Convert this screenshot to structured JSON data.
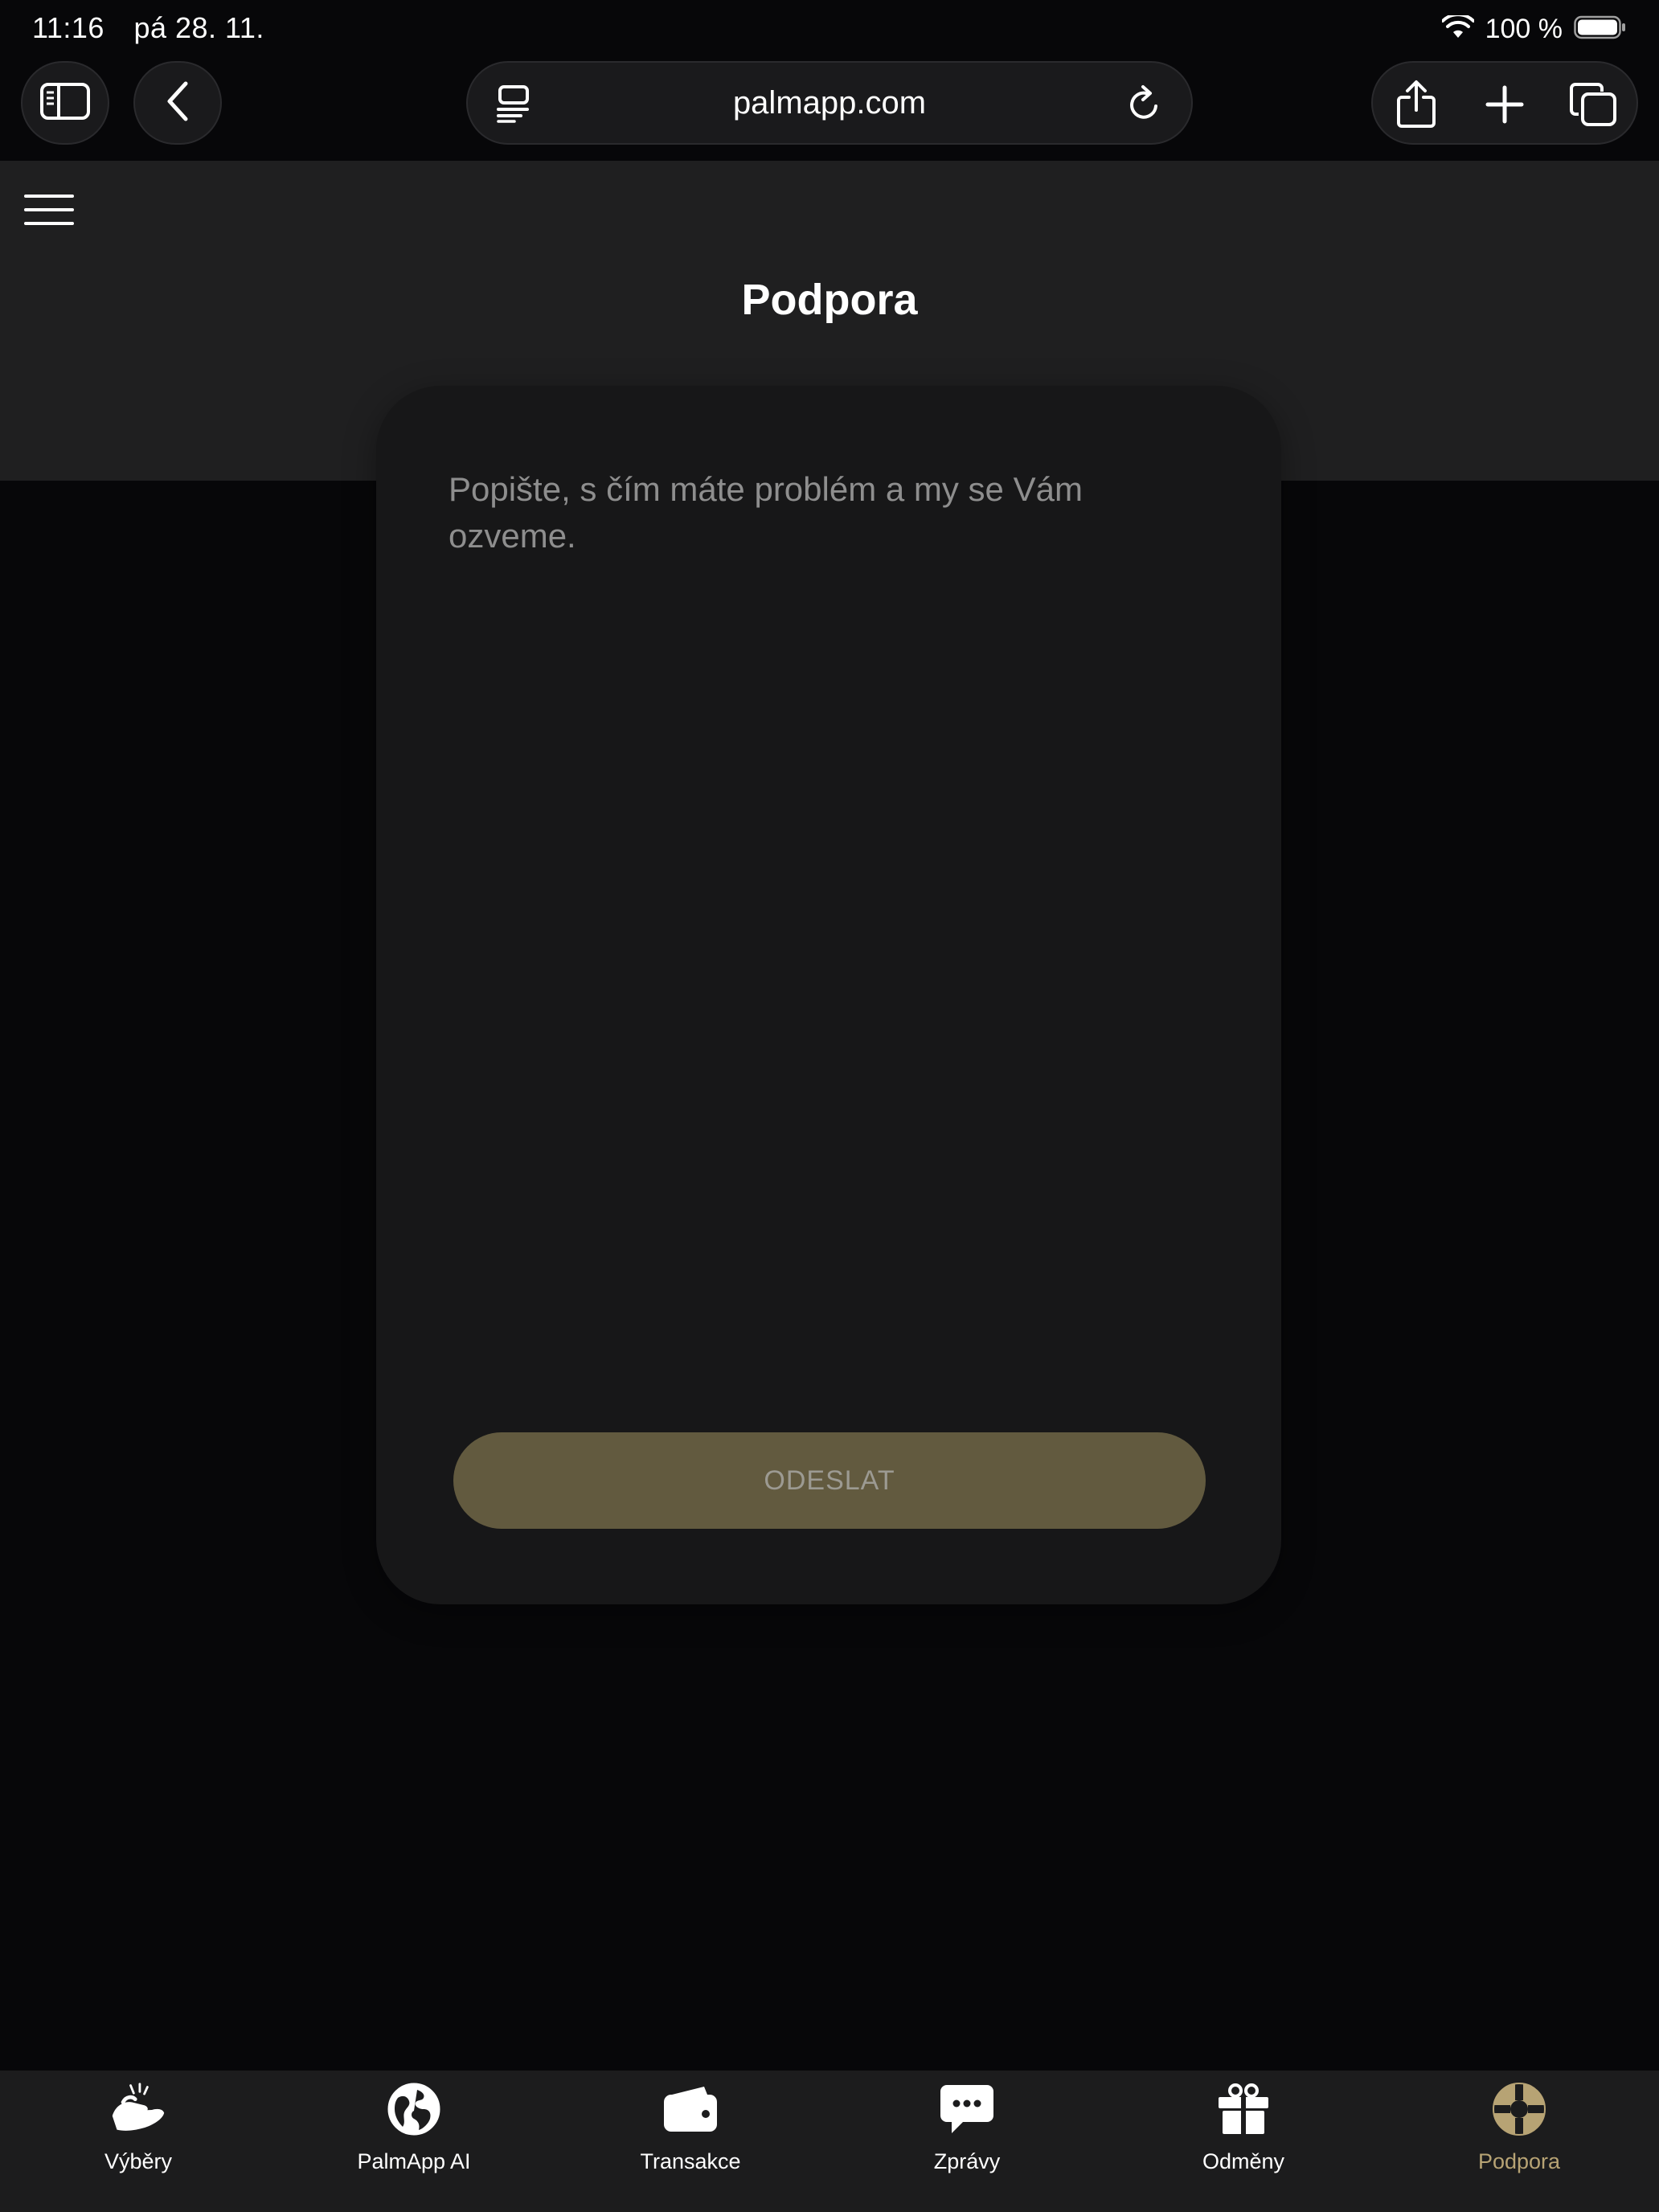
{
  "status_bar": {
    "time": "11:16",
    "date": "pá 28. 11.",
    "battery_percent": "100 %",
    "battery_level": 1.0
  },
  "browser": {
    "url": "palmapp.com",
    "icons": {
      "sidebar": "sidebar-icon",
      "back": "chevron-left-icon",
      "reader": "reader-icon",
      "reload": "reload-icon",
      "share": "share-icon",
      "new_tab": "plus-icon",
      "tabs": "tabs-icon"
    }
  },
  "header": {
    "menu_icon": "hamburger-icon",
    "title": "Podpora"
  },
  "support_form": {
    "message_placeholder": "Popište, s čím máte problém a my se Vám ozveme.",
    "message_value": "",
    "submit_label": "ODESLAT"
  },
  "bottom_nav": {
    "items": [
      {
        "label": "Výběry",
        "icon": "hand-coins-icon",
        "active": false
      },
      {
        "label": "PalmApp AI",
        "icon": "globe-icon",
        "active": false
      },
      {
        "label": "Transakce",
        "icon": "wallet-icon",
        "active": false
      },
      {
        "label": "Zprávy",
        "icon": "chat-bubble-icon",
        "active": false
      },
      {
        "label": "Odměny",
        "icon": "gift-icon",
        "active": false
      },
      {
        "label": "Podpora",
        "icon": "lifebuoy-icon",
        "active": true
      }
    ]
  },
  "colors": {
    "background": "#070709",
    "header": "#1f1f20",
    "card": "#171718",
    "accent": "#b7a374",
    "button_disabled": "#625a3f"
  }
}
